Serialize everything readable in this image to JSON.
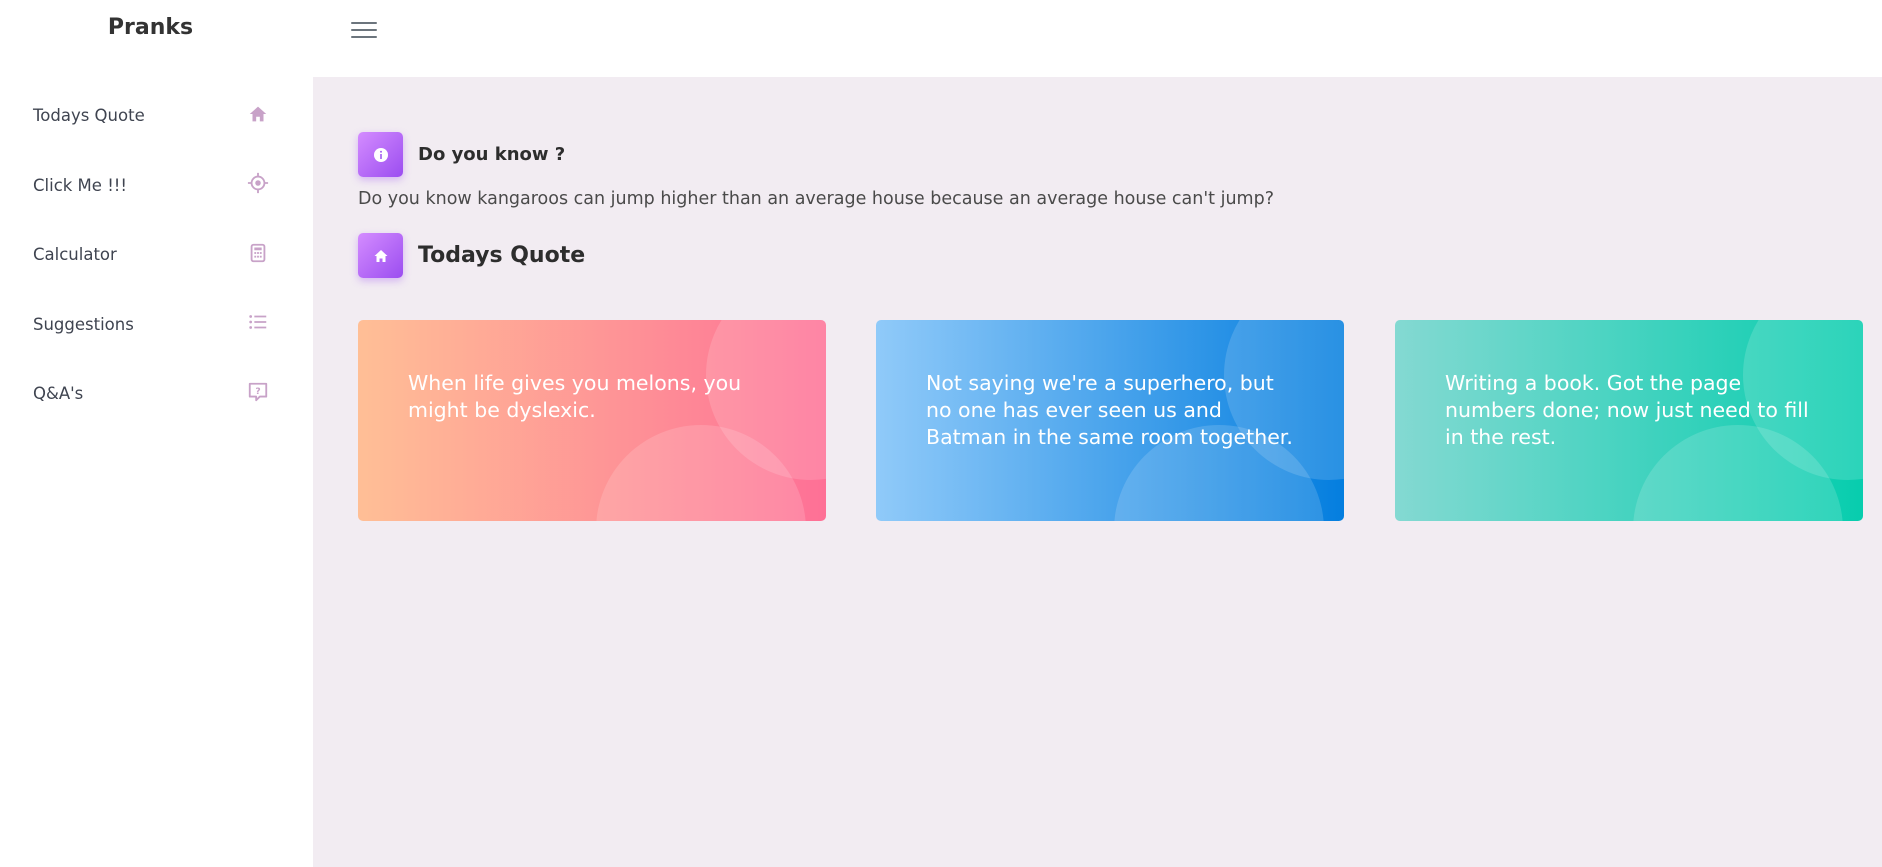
{
  "app": {
    "brand": "Pranks"
  },
  "sidebar": {
    "items": [
      {
        "label": "Todays Quote",
        "icon": "home-icon"
      },
      {
        "label": "Click Me !!!",
        "icon": "crosshairs-icon"
      },
      {
        "label": "Calculator",
        "icon": "calculator-icon"
      },
      {
        "label": "Suggestions",
        "icon": "list-icon"
      },
      {
        "label": "Q&A's",
        "icon": "question-bubble-icon"
      }
    ],
    "icon_color": "#c8a2c8"
  },
  "fact": {
    "title": "Do you know ?",
    "icon": "info-icon",
    "text": "Do you know kangaroos can jump higher than an average house because an average house can't jump?"
  },
  "quotes": {
    "title": "Todays Quote",
    "icon": "home-icon",
    "cards": [
      {
        "text": "When life gives you melons, you might be dyslexic.",
        "gradient": [
          "#ffbf96",
          "#fe7096"
        ]
      },
      {
        "text": "Not saying we're a superhero, but no one has ever seen us and Batman in the same room together.",
        "gradient": [
          "#90caf9",
          "#047edf"
        ]
      },
      {
        "text": "Writing a book. Got the page numbers done; now just need to fill in the rest.",
        "gradient": [
          "#84d9d2",
          "#07cdae"
        ]
      }
    ]
  },
  "colors": {
    "page_background": "#f2ecf2",
    "badge_gradient": [
      "#d48cff",
      "#9b4df0"
    ]
  }
}
